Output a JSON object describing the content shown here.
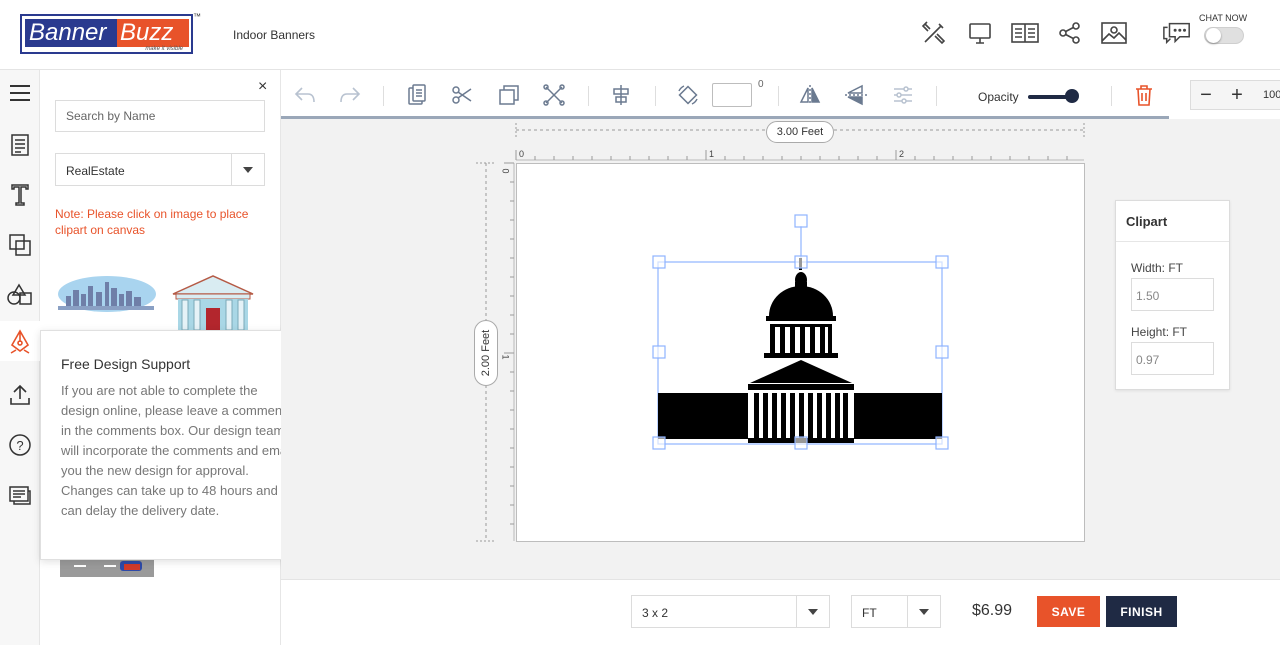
{
  "header": {
    "logo_part1": "Banner",
    "logo_part2": "Buzz",
    "logo_tagline": "make it visible",
    "logo_tm": "™",
    "title": "Indoor Banners",
    "chat_label": "CHAT NOW",
    "icons": [
      "tools-icon",
      "monitor-icon",
      "book-icon",
      "share-icon",
      "image-icon",
      "chat-icon"
    ]
  },
  "rail": {
    "icons": [
      "menu-icon",
      "template-icon",
      "text-icon",
      "layers-icon",
      "shapes-icon",
      "clipart-icon",
      "upload-icon",
      "help-icon",
      "comments-icon"
    ]
  },
  "panel": {
    "close": "×",
    "search_placeholder": "Search by Name",
    "category": "RealEstate",
    "note": "Note: Please click on image to place clipart on canvas"
  },
  "popup": {
    "title": "Free Design Support",
    "close": "×",
    "body": "If you are not able to complete the design online, please leave a comments in the comments box. Our design team will incorporate the comments and email you the new design for approval. Changes can take up to 48 hours and can delay the delivery date."
  },
  "toolbar": {
    "degree_symbol": "0",
    "opacity_label": "Opacity",
    "opacity_value": 1.0,
    "zoom_minus": "−",
    "zoom_plus": "+",
    "zoom_value": "100"
  },
  "canvas": {
    "width_label": "3.00 Feet",
    "height_label": "2.00 Feet",
    "ruler_top": [
      "0",
      "1",
      "2"
    ],
    "ruler_left": [
      "0",
      "1"
    ]
  },
  "clipart_panel": {
    "title": "Clipart",
    "width_label": "Width: FT",
    "width_value": "1.50",
    "height_label": "Height: FT",
    "height_value": "0.97"
  },
  "footer": {
    "size": "3 x 2",
    "unit": "FT",
    "price": "$6.99",
    "save": "SAVE",
    "finish": "FINISH"
  },
  "colors": {
    "brand_blue": "#2a3a8f",
    "brand_orange": "#e8532a",
    "finish_dark": "#1f2a44",
    "selection": "#8fb3ff"
  }
}
